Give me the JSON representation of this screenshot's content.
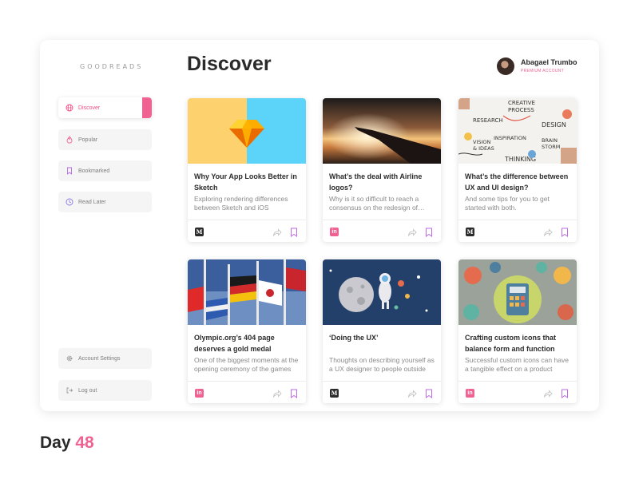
{
  "brand": "GOODREADS",
  "sidebar": {
    "items": [
      {
        "label": "Discover",
        "icon": "globe-icon"
      },
      {
        "label": "Popular",
        "icon": "flame-icon"
      },
      {
        "label": "Bookmarked",
        "icon": "bookmark-icon"
      },
      {
        "label": "Read Later",
        "icon": "clock-icon"
      }
    ],
    "bottom": [
      {
        "label": "Account Settings",
        "icon": "gear-icon"
      },
      {
        "label": "Log out",
        "icon": "logout-icon"
      }
    ]
  },
  "header": {
    "title": "Discover"
  },
  "user": {
    "name": "Abagael Trumbo",
    "badge": "PREMIUM ACCOUNT"
  },
  "cards": [
    {
      "title": "Why Your App Looks Better in Sketch",
      "desc": "Exploring rendering differences between Sketch and iOS",
      "source": "M"
    },
    {
      "title": "What’s the deal with Airline logos?",
      "desc": "Why is it so difficult to reach a consensus on the redesign of airline logos?",
      "source": "in"
    },
    {
      "title": "What’s the difference between UX and UI design?",
      "desc": "And some tips for you to get started with both.",
      "source": "M"
    },
    {
      "title": "Olympic.org’s 404 page deserves a gold medal",
      "desc": "One of the biggest moments at the opening ceremony of the games",
      "source": "in"
    },
    {
      "title": "‘Doing the UX’",
      "desc": "Thoughts on describing yourself as a UX designer to people outside",
      "source": "M"
    },
    {
      "title": "Crafting custom icons that balance form and function",
      "desc": "Successful custom icons can have a tangible effect on a product",
      "source": "in"
    }
  ],
  "image_words": [
    "CREATIVE",
    "PROCESS",
    "RESEARCH",
    "DESIGN",
    "VISION",
    "& IDEAS",
    "INSPIRATION",
    "BRAIN",
    "STORM",
    "THINKING"
  ],
  "footer": {
    "day_label": "Day",
    "day_number": "48"
  },
  "colors": {
    "accent": "#f06292",
    "text": "#2b2b2b",
    "muted": "#8a8a8a"
  }
}
